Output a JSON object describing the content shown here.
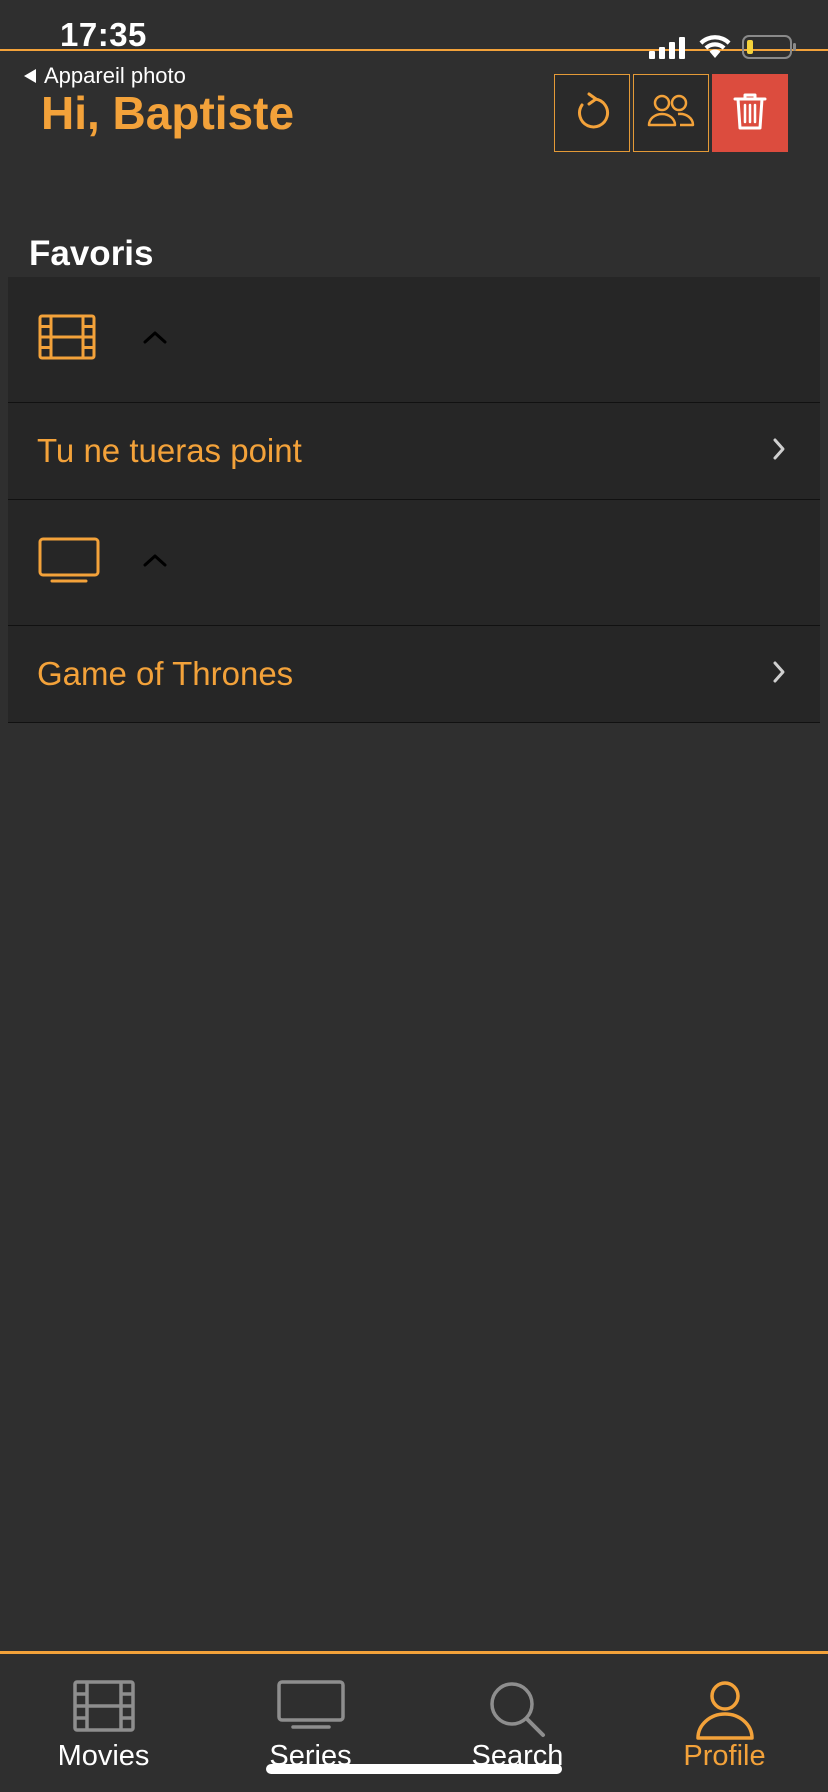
{
  "status_bar": {
    "time": "17:35",
    "icons": [
      "signal-icon",
      "wifi-icon",
      "battery-icon"
    ]
  },
  "nav": {
    "back_label": "Appareil photo",
    "greeting": "Hi, Baptiste",
    "actions": [
      {
        "icon": "refresh-icon"
      },
      {
        "icon": "users-icon"
      },
      {
        "icon": "trash-icon"
      }
    ]
  },
  "favorites": {
    "title": "Favoris",
    "groups": [
      {
        "icon": "film-icon",
        "items": [
          {
            "label": "Tu ne tueras point"
          }
        ]
      },
      {
        "icon": "tv-icon",
        "items": [
          {
            "label": "Game of Thrones"
          }
        ]
      }
    ]
  },
  "tab_bar": {
    "tabs": [
      {
        "label": "Movies",
        "icon": "film-icon",
        "active": false
      },
      {
        "label": "Series",
        "icon": "tv-icon",
        "active": false
      },
      {
        "label": "Search",
        "icon": "search-icon",
        "active": false
      },
      {
        "label": "Profile",
        "icon": "person-icon",
        "active": true
      }
    ]
  },
  "colors": {
    "accent": "#f3a23a",
    "background": "#2f2f2f",
    "row_background": "#262626",
    "danger": "#dc4c3e",
    "inactive_icon": "#8e8e8e"
  }
}
